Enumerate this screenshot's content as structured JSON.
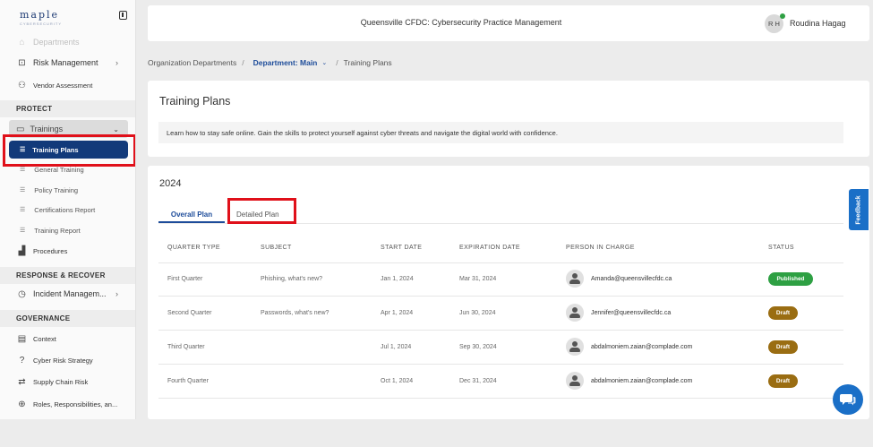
{
  "app": {
    "logo": "maple",
    "logo_sub": "CYBERSECURITY",
    "header_title": "Queensville CFDC: Cybersecurity Practice Management",
    "user_initials": "R H",
    "user_name": "Roudina Hagag"
  },
  "sidebar": {
    "top_faded": "Departments",
    "risk_management": "Risk Management",
    "vendor_assessment": "Vendor Assessment",
    "protect": "PROTECT",
    "trainings": "Trainings",
    "training_plans": "Training Plans",
    "general_training": "General Training",
    "policy_training": "Policy Training",
    "certifications_report": "Certifications Report",
    "training_report": "Training Report",
    "procedures": "Procedures",
    "response_recover": "RESPONSE & RECOVER",
    "incident_management": "Incident Managem...",
    "governance": "GOVERNANCE",
    "context": "Context",
    "cyber_risk_strategy": "Cyber Risk Strategy",
    "supply_chain_risk": "Supply Chain Risk",
    "roles": "Roles, Responsibilities, an..."
  },
  "breadcrumb": {
    "root": "Organization Departments",
    "department": "Department: Main",
    "current": "Training Plans"
  },
  "intro": {
    "title": "Training Plans",
    "description": "Learn how to stay safe online. Gain the skills to protect yourself against cyber threats and navigate the digital world with confidence."
  },
  "plan": {
    "year": "2024",
    "tabs": {
      "overall": "Overall Plan",
      "detailed": "Detailed Plan"
    },
    "columns": {
      "quarter_type": "QUARTER TYPE",
      "subject": "SUBJECT",
      "start_date": "START DATE",
      "expiration_date": "EXPIRATION DATE",
      "person": "PERSON IN CHARGE",
      "status": "STATUS"
    },
    "rows": [
      {
        "quarter": "First Quarter",
        "subject": "Phishing, what's new?",
        "start": "Jan 1, 2024",
        "expiration": "Mar 31, 2024",
        "person": "Amanda@queensvillecfdc.ca",
        "status": "Published"
      },
      {
        "quarter": "Second Quarter",
        "subject": "Passwords, what's new?",
        "start": "Apr 1, 2024",
        "expiration": "Jun 30, 2024",
        "person": "Jennifer@queensvillecfdc.ca",
        "status": "Draft"
      },
      {
        "quarter": "Third Quarter",
        "subject": "",
        "start": "Jul 1, 2024",
        "expiration": "Sep 30, 2024",
        "person": "abdalmoniem.zaian@complade.com",
        "status": "Draft"
      },
      {
        "quarter": "Fourth Quarter",
        "subject": "",
        "start": "Oct 1, 2024",
        "expiration": "Dec 31, 2024",
        "person": "abdalmoniem.zaian@complade.com",
        "status": "Draft"
      }
    ]
  },
  "feedback_label": "Feedback",
  "colors": {
    "active_nav": "#123a7a",
    "accent": "#1d4c9a",
    "published": "#2ea043",
    "draft": "#9a6d12",
    "highlight": "#e0101a"
  }
}
